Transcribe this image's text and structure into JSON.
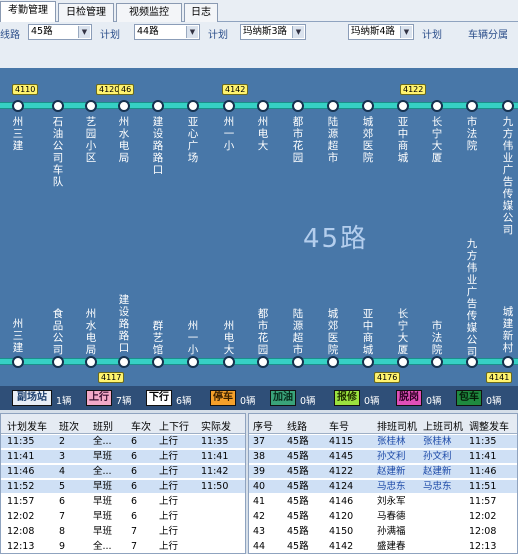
{
  "tabs": [
    "考勤管理",
    "日检管理",
    "视频监控",
    "日志"
  ],
  "filters": {
    "route_label_left": "线路",
    "route_a": "45路",
    "plan_label": "计划",
    "route_b": "44路",
    "plan_label_2": "计划",
    "vehicle_a": "玛纳斯3路",
    "vehicle_b": "玛纳斯4路",
    "plan_label_3": "计划",
    "vehicle_group_label": "车辆分属"
  },
  "map": {
    "watermark": "45路",
    "top_stations": [
      "州三建",
      "石油公司车队",
      "艺园小区",
      "州水电局",
      "建设路路口",
      "亚心广场",
      "州一小",
      "州电大",
      "都市花园",
      "陆源超市",
      "城郊医院",
      "亚中商城",
      "长宁大厦",
      "市法院",
      "九方伟业广告传媒公司"
    ],
    "bottom_stations": [
      "州三建",
      "食品公司",
      "州水电局",
      "建设路路口",
      "群艺馆",
      "州一小",
      "州电大",
      "都市花园",
      "陆源超市",
      "城郊医院",
      "亚中商城",
      "长宁大厦",
      "市法院",
      "九方伟业广告传媒公司",
      "城建新村"
    ],
    "top_buses": [
      "4110",
      "4120",
      "46",
      "4142",
      "4122"
    ],
    "bottom_buses": [
      "4117",
      "4176",
      "4141"
    ]
  },
  "legend": [
    {
      "label": "副场站",
      "count": "1辆",
      "bg": "#e8eef6",
      "fg": "#1d3f6e"
    },
    {
      "label": "上行",
      "count": "7辆",
      "bg": "#f3a9c7",
      "fg": "#3a1030"
    },
    {
      "label": "下行",
      "count": "6辆",
      "bg": "#ffffff",
      "fg": "#000000"
    },
    {
      "label": "停车",
      "count": "0辆",
      "bg": "#f5a02a",
      "fg": "#3a2000"
    },
    {
      "label": "加油",
      "count": "0辆",
      "bg": "#3aa37a",
      "fg": "#062a1a"
    },
    {
      "label": "报修",
      "count": "0辆",
      "bg": "#9be23f",
      "fg": "#203000"
    },
    {
      "label": "脱岗",
      "count": "0辆",
      "bg": "#e14fb8",
      "fg": "#2a0022"
    },
    {
      "label": "包车",
      "count": "0辆",
      "bg": "#1f8a3f",
      "fg": "#041a08"
    }
  ],
  "plan_table": {
    "headers": [
      "计划发车",
      "班次",
      "班别",
      "车次",
      "上下行",
      "实际发"
    ],
    "rows": [
      [
        "11:35",
        "2",
        "全...",
        "6",
        "上行",
        "11:35"
      ],
      [
        "11:41",
        "3",
        "早班",
        "6",
        "上行",
        "11:41"
      ],
      [
        "11:46",
        "4",
        "全...",
        "6",
        "上行",
        "11:42"
      ],
      [
        "11:52",
        "5",
        "早班",
        "6",
        "上行",
        "11:50"
      ],
      [
        "11:57",
        "6",
        "早班",
        "6",
        "上行",
        ""
      ],
      [
        "12:02",
        "7",
        "早班",
        "6",
        "上行",
        ""
      ],
      [
        "12:08",
        "8",
        "早班",
        "7",
        "上行",
        ""
      ],
      [
        "12:13",
        "9",
        "全...",
        "7",
        "上行",
        ""
      ]
    ]
  },
  "dispatch_table": {
    "headers": [
      "序号",
      "线路",
      "车号",
      "排班司机",
      "上班司机",
      "调整发车"
    ],
    "rows": [
      [
        "37",
        "45路",
        "4115",
        "张桂林",
        "张桂林",
        "11:35"
      ],
      [
        "38",
        "45路",
        "4145",
        "孙文利",
        "孙文利",
        "11:41"
      ],
      [
        "39",
        "45路",
        "4122",
        "赵建新",
        "赵建新",
        "11:46"
      ],
      [
        "40",
        "45路",
        "4124",
        "马忠东",
        "马忠东",
        "11:51"
      ],
      [
        "41",
        "45路",
        "4146",
        "刘永军",
        "",
        "11:57"
      ],
      [
        "42",
        "45路",
        "4120",
        "马春德",
        "",
        "12:02"
      ],
      [
        "43",
        "45路",
        "4150",
        "孙满福",
        "",
        "12:08"
      ],
      [
        "44",
        "45路",
        "4142",
        "盛建春",
        "",
        "12:13"
      ]
    ]
  }
}
